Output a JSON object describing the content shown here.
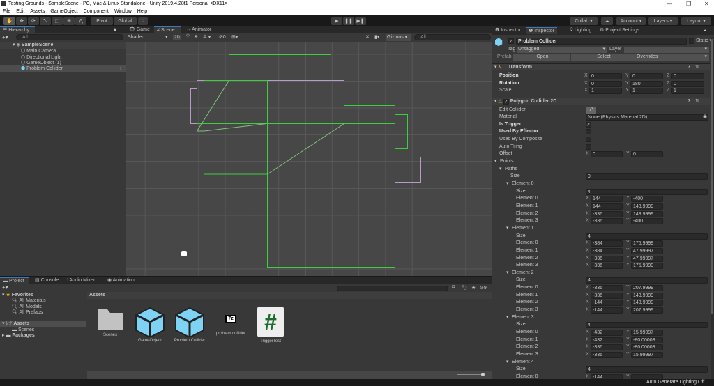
{
  "window": {
    "title": "Testing Grounds - SampleScene - PC, Mac & Linux Standalone - Unity 2019.4.28f1 Personal <DX11>",
    "minimize": "—",
    "maximize": "❐",
    "close": "✕"
  },
  "menu": [
    "File",
    "Edit",
    "Assets",
    "GameObject",
    "Component",
    "Window",
    "Help"
  ],
  "toolbar": {
    "pivot": "Pivot",
    "global": "Global",
    "play": "▶",
    "pause": "❚❚",
    "step": "▶❚",
    "collab": "Collab ▾",
    "account": "Account",
    "layers": "Layers",
    "layout": "Layout",
    "cloud": "☁"
  },
  "hierarchy": {
    "tab": "Hierarchy",
    "search_placeholder": "All",
    "add": "+▾",
    "scene": "SampleScene",
    "items": [
      "Main Camera",
      "Directional Light",
      "GameObject (1)",
      "Problem Collider"
    ]
  },
  "scene_tabs": {
    "game": "Game",
    "scene": "Scene",
    "animator": "Animator"
  },
  "scene_toolbar": {
    "shading": "Shaded",
    "mode2d": "2D",
    "fx_count": "0",
    "gizmos": "Gizmos",
    "search_placeholder": "All"
  },
  "project": {
    "tabs": [
      "Project",
      "Console",
      "Audio Mixer",
      "Animation"
    ],
    "add": "+▾",
    "hidden_count": "9",
    "favorites": "Favorites",
    "fav_items": [
      "All Materials",
      "All Models",
      "All Prefabs"
    ],
    "assets": "Assets",
    "scenes": "Scenes",
    "packages": "Packages",
    "breadcrumb": "Assets",
    "items": [
      {
        "name": "Scenes",
        "icon": "folder-icon"
      },
      {
        "name": "GameObject",
        "icon": "prefab-icon"
      },
      {
        "name": "Problem Collider",
        "icon": "prefab-icon"
      },
      {
        "name": "problem collider",
        "icon": "7z-archive-icon"
      },
      {
        "name": "TriggerTest",
        "icon": "csharp-script-icon"
      }
    ]
  },
  "inspector": {
    "tabs": [
      "Inspector",
      "Inspector",
      "Lighting",
      "Project Settings"
    ],
    "object_name": "Problem Collider",
    "static": "Static ▾",
    "tag_label": "Tag",
    "tag": "Untagged",
    "layer_label": "Layer",
    "layer": "",
    "prefab_label": "Prefab",
    "open": "Open",
    "select": "Select",
    "overrides": "Overrides",
    "transform": {
      "title": "Transform",
      "position_label": "Position",
      "rotation_label": "Rotation",
      "scale_label": "Scale",
      "position": [
        "0",
        "0",
        "0"
      ],
      "rotation": [
        "0",
        "180",
        "0"
      ],
      "scale": [
        "1",
        "1",
        "1"
      ]
    },
    "collider": {
      "title": "Polygon Collider 2D",
      "edit_collider": "Edit Collider",
      "material_label": "Material",
      "material": "None (Physics Material 2D)",
      "is_trigger": "Is Trigger",
      "is_trigger_checked": true,
      "used_by_effector": "Used By Effector",
      "used_by_composite": "Used By Composite",
      "auto_tiling": "Auto Tiling",
      "offset_label": "Offset",
      "offset": [
        "0",
        "0"
      ],
      "points": "Points",
      "paths": "Paths",
      "size_label": "Size",
      "paths_size": "9",
      "elements": [
        {
          "label": "Element 0",
          "size": "4",
          "points": [
            [
              "144",
              "-400"
            ],
            [
              "144",
              "143.9999"
            ],
            [
              "-336",
              "143.9999"
            ],
            [
              "-336",
              "-400"
            ]
          ]
        },
        {
          "label": "Element 1",
          "size": "4",
          "points": [
            [
              "-384",
              "175.9999"
            ],
            [
              "-384",
              "47.99997"
            ],
            [
              "-336",
              "47.99997"
            ],
            [
              "-336",
              "175.9999"
            ]
          ]
        },
        {
          "label": "Element 2",
          "size": "4",
          "points": [
            [
              "-336",
              "207.9999"
            ],
            [
              "-336",
              "143.9999"
            ],
            [
              "-144",
              "143.9999"
            ],
            [
              "-144",
              "207.9999"
            ]
          ]
        },
        {
          "label": "Element 3",
          "size": "4",
          "points": [
            [
              "-432",
              "15.99997"
            ],
            [
              "-432",
              "-80.00003"
            ],
            [
              "-336",
              "-80.00003"
            ],
            [
              "-336",
              "15.99997"
            ]
          ]
        },
        {
          "label": "Element 4",
          "size": "4",
          "points": [
            [
              "-144",
              ""
            ]
          ]
        }
      ]
    }
  },
  "status": {
    "lighting": "Auto Generate Lighting Off"
  },
  "colors": {
    "collider": "#3ccf3c",
    "collider_alt": "#b89cc8",
    "selection": "#3a79bb",
    "prefab": "#7ed3f5",
    "script_hash": "#1e6b2e"
  }
}
